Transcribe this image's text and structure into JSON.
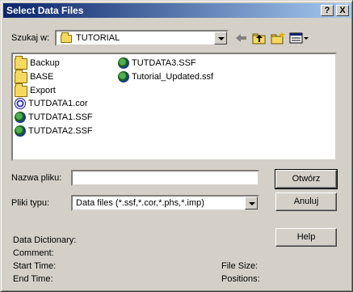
{
  "window": {
    "title": "Select Data Files",
    "help_glyph": "?",
    "close_glyph": "X"
  },
  "look_in": {
    "label": "Szukaj w:",
    "value": "TUTORIAL"
  },
  "files": [
    {
      "name": "Backup",
      "icon": "folder-icon"
    },
    {
      "name": "BASE",
      "icon": "folder-icon"
    },
    {
      "name": "Export",
      "icon": "folder-icon"
    },
    {
      "name": "TUTDATA1.cor",
      "icon": "cor-file-icon"
    },
    {
      "name": "TUTDATA1.SSF",
      "icon": "ssf-file-icon"
    },
    {
      "name": "TUTDATA2.SSF",
      "icon": "ssf-file-icon"
    },
    {
      "name": "TUTDATA3.SSF",
      "icon": "ssf-file-icon"
    },
    {
      "name": "Tutorial_Updated.ssf",
      "icon": "ssf-file-icon"
    }
  ],
  "filename": {
    "label": "Nazwa pliku:",
    "value": ""
  },
  "filetype": {
    "label": "Pliki typu:",
    "value": "Data files (*.ssf,*.cor,*.phs,*.imp)"
  },
  "buttons": {
    "open": "Otwórz",
    "cancel": "Anuluj",
    "help": "Help"
  },
  "info": {
    "data_dictionary": "Data Dictionary:",
    "comment": "Comment:",
    "start_time": "Start Time:",
    "end_time": "End Time:",
    "file_size": "File Size:",
    "positions": "Positions:"
  }
}
